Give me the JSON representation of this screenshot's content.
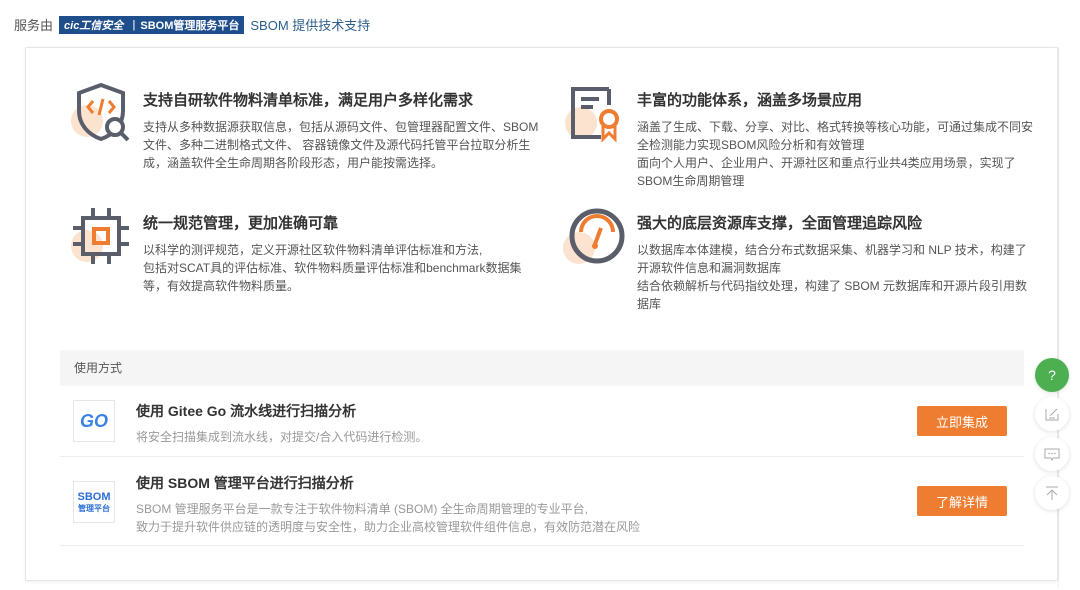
{
  "top": {
    "prefix": "服务由",
    "badge_logo": "cic工信安全",
    "badge_title": "SBOM管理服务平台",
    "suffix": "SBOM 提供技术支持"
  },
  "features": [
    {
      "icon": "shield-code-search-icon",
      "title": "支持自研软件物料清单标准，满足用户多样化需求",
      "desc": "支持从多种数据源获取信息，包括从源码文件、包管理器配置文件、SBOM 文件、多种二进制格式文件、 容器镜像文件及源代码托管平台拉取分析生成，涵盖软件全生命周期各阶段形态，用户能按需选择。"
    },
    {
      "icon": "certificate-icon",
      "title": "丰富的功能体系，涵盖多场景应用",
      "desc1": "涵盖了生成、下载、分享、对比、格式转换等核心功能，可通过集成不同安全检测能力实现SBOM风险分析和有效管理",
      "desc2": "面向个人用户、企业用户、开源社区和重点行业共4类应用场景，实现了SBOM生命周期管理"
    },
    {
      "icon": "chip-icon",
      "title": "统一规范管理，更加准确可靠",
      "desc1": "以科学的测评规范，定义开源社区软件物料清单评估标准和方法,",
      "desc2": "包括对SCAT具的评估标准、软件物料质量评估标准和benchmark数据集等，有效提高软件物料质量。"
    },
    {
      "icon": "gauge-icon",
      "title": "强大的底层资源库支撑，全面管理追踪风险",
      "desc1": "以数据库本体建模，结合分布式数据采集、机器学习和 NLP 技术，构建了开源软件信息和漏洞数据库",
      "desc2": "结合依赖解析与代码指纹处理，构建了 SBOM 元数据库和开源片段引用数据库"
    }
  ],
  "usage": {
    "header": "使用方式",
    "rows": [
      {
        "logo": "GO",
        "title": "使用 Gitee Go 流水线进行扫描分析",
        "desc": "将安全扫描集成到流水线，对提交/合入代码进行检测。",
        "button": "立即集成"
      },
      {
        "logo1": "SBOM",
        "logo2": "管理平台",
        "title": "使用 SBOM 管理平台进行扫描分析",
        "desc1": "SBOM 管理服务平台是一款专注于软件物料清单 (SBOM) 全生命周期管理的专业平台,",
        "desc2": "致力于提升软件供应链的透明度与安全性，助力企业高校管理软件组件信息，有效防范潜在风险",
        "button": "了解详情"
      }
    ]
  },
  "fabs": {
    "help": "?"
  },
  "colors": {
    "accent": "#ef7d31",
    "help": "#4caf50",
    "brand": "#1f4e8c"
  }
}
